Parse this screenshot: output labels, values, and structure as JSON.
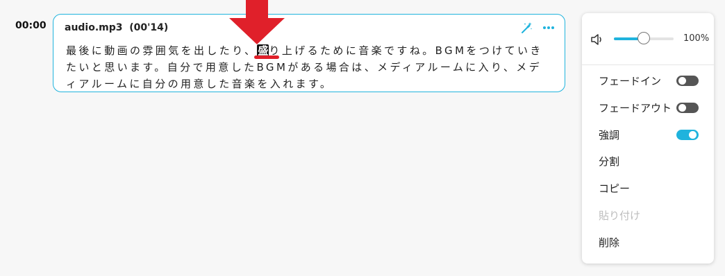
{
  "timeline": {
    "timestamp": "00:00"
  },
  "clip": {
    "title": "audio.mp3  (00'14)",
    "transcript_before": "最後に動画の雰囲気を出したり、",
    "highlight_char": "盛",
    "transcript_after": "り上げるために音楽ですね。BGMをつけていきたいと思います。自分で用意したBGMがある場合は、メディアルームに入り、メディアルームに自分の用意した音楽を入れます。"
  },
  "menu": {
    "volume": {
      "percent_label": "100%",
      "level": 0.5
    },
    "items": [
      {
        "label": "フェードイン",
        "toggle": "off"
      },
      {
        "label": "フェードアウト",
        "toggle": "off"
      },
      {
        "label": "強調",
        "toggle": "on"
      },
      {
        "label": "分割"
      },
      {
        "label": "コピー"
      },
      {
        "label": "貼り付け",
        "disabled": true
      },
      {
        "label": "削除"
      }
    ]
  },
  "colors": {
    "accent": "#1fb3dd",
    "annotation": "#e0202a",
    "toggle_off": "#555555"
  },
  "icons": [
    "magic-wand-icon",
    "more-icon",
    "volume-icon",
    "down-arrow-annotation"
  ]
}
